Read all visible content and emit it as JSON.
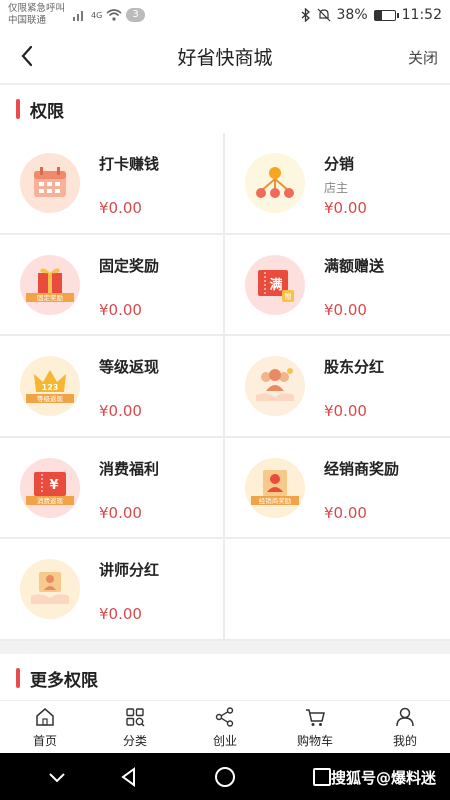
{
  "status_bar": {
    "line1": "仅限紧急呼叫",
    "line2": "中国联通",
    "network": "4G",
    "notification_count": "3",
    "battery_percent": "38%",
    "battery_level": 0.38,
    "time": "11:52"
  },
  "header": {
    "title": "好省快商城",
    "close_label": "关闭"
  },
  "section_permissions": {
    "title": "权限"
  },
  "permissions": [
    {
      "name": "打卡赚钱",
      "sub": "",
      "amount": "¥0.00",
      "icon": "calendar-icon",
      "bg": "#fde4d6"
    },
    {
      "name": "分销",
      "sub": "店主",
      "amount": "¥0.00",
      "icon": "distribution-tree-icon",
      "bg": "#fdf7e0"
    },
    {
      "name": "固定奖励",
      "sub": "",
      "amount": "¥0.00",
      "icon": "gift-box-icon",
      "bg": "#fde0de"
    },
    {
      "name": "满额赠送",
      "sub": "",
      "amount": "¥0.00",
      "icon": "coupon-icon",
      "bg": "#fde0de"
    },
    {
      "name": "等级返现",
      "sub": "",
      "amount": "¥0.00",
      "icon": "crown-icon",
      "bg": "#fdf0d6"
    },
    {
      "name": "股东分红",
      "sub": "",
      "amount": "¥0.00",
      "icon": "shareholders-icon",
      "bg": "#fdeede"
    },
    {
      "name": "消费福利",
      "sub": "",
      "amount": "¥0.00",
      "icon": "yuan-ticket-icon",
      "bg": "#fde0de"
    },
    {
      "name": "经销商奖励",
      "sub": "",
      "amount": "¥0.00",
      "icon": "dealer-icon",
      "bg": "#fdf0d6"
    },
    {
      "name": "讲师分红",
      "sub": "",
      "amount": "¥0.00",
      "icon": "lecturer-icon",
      "bg": "#fdf0d6"
    }
  ],
  "icon_ribbon_text": {
    "gift": "固定奖励",
    "crown": "等级返现",
    "ticket": "消费返现",
    "dealer": "经销商奖励"
  },
  "section_more": {
    "title": "更多权限"
  },
  "tabbar": [
    {
      "label": "首页",
      "icon": "home-icon"
    },
    {
      "label": "分类",
      "icon": "category-grid-icon"
    },
    {
      "label": "创业",
      "icon": "share-icon"
    },
    {
      "label": "购物车",
      "icon": "cart-icon"
    },
    {
      "label": "我的",
      "icon": "user-icon"
    }
  ],
  "watermark": "搜狐号@爆料迷",
  "colors": {
    "accent": "#e84c4c",
    "amount": "#d84a4a"
  }
}
